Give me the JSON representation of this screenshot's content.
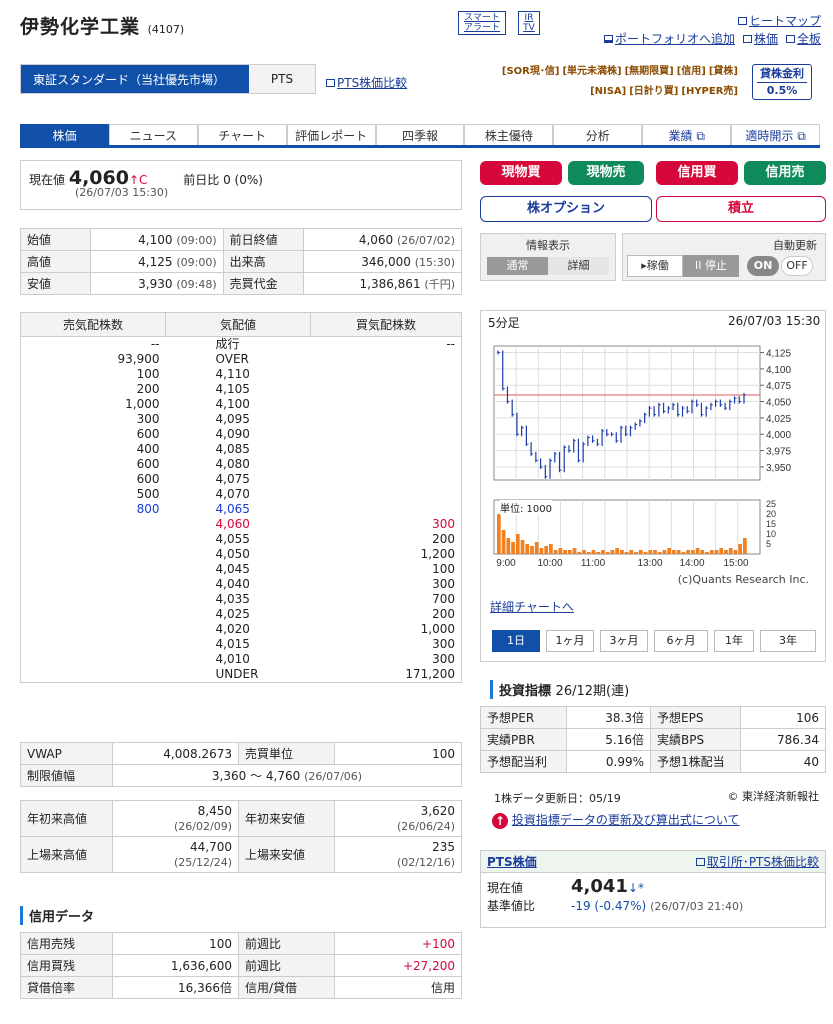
{
  "header": {
    "company": "伊勢化学工業",
    "code": "(4107)",
    "smart_alert": [
      "スマート",
      "アラート"
    ],
    "ir": [
      "IR",
      "TV"
    ],
    "links": {
      "heatmap": "ヒートマップ",
      "portfolio": "ポートフォリオへ追加",
      "stock": "株価",
      "full": "全板"
    }
  },
  "market": {
    "tse": "東証スタンダード（当社優先市場）",
    "pts": "PTS",
    "pts_compare": "PTS株価比較",
    "tags1": [
      "[SOR現･信]",
      "[単元未満株]",
      "[無期限買]",
      "[信用]",
      "[貸株]"
    ],
    "tags2": [
      "[NISA]",
      "[日計り買]",
      "[HYPER売]"
    ],
    "loan": "貸株金利",
    "loan_rate": "0.5%"
  },
  "tabs": [
    "株価",
    "ニュース",
    "チャート",
    "評価レポート",
    "四季報",
    "株主優待",
    "分析",
    "業績",
    "適時開示"
  ],
  "price": {
    "label": "現在値",
    "value": "4,060",
    "arrow": "↑C",
    "change_label": "前日比",
    "change": "0 (0%)",
    "time": "(26/07/03 15:30)"
  },
  "ohlc": [
    [
      "始値",
      "4,100",
      "(09:00)",
      "前日終値",
      "4,060",
      "(26/07/02)"
    ],
    [
      "高値",
      "4,125",
      "(09:00)",
      "出来高",
      "346,000",
      "(15:30)"
    ],
    [
      "安値",
      "3,930",
      "(09:48)",
      "売買代金",
      "1,386,861",
      "(千円)"
    ]
  ],
  "board": {
    "headers": [
      "売気配株数",
      "気配値",
      "買気配株数"
    ],
    "rows": [
      [
        "--",
        "成行",
        "--"
      ],
      [
        "93,900",
        "OVER",
        ""
      ],
      [
        "100",
        "4,110",
        ""
      ],
      [
        "200",
        "4,105",
        ""
      ],
      [
        "1,000",
        "4,100",
        ""
      ],
      [
        "300",
        "4,095",
        ""
      ],
      [
        "600",
        "4,090",
        ""
      ],
      [
        "400",
        "4,085",
        ""
      ],
      [
        "600",
        "4,080",
        ""
      ],
      [
        "600",
        "4,075",
        ""
      ],
      [
        "500",
        "4,070",
        ""
      ],
      [
        "800",
        "4,065",
        ""
      ],
      [
        "",
        "4,060",
        "300"
      ],
      [
        "",
        "4,055",
        "200"
      ],
      [
        "",
        "4,050",
        "1,200"
      ],
      [
        "",
        "4,045",
        "100"
      ],
      [
        "",
        "4,040",
        "300"
      ],
      [
        "",
        "4,035",
        "700"
      ],
      [
        "",
        "4,025",
        "200"
      ],
      [
        "",
        "4,020",
        "1,000"
      ],
      [
        "",
        "4,015",
        "300"
      ],
      [
        "",
        "4,010",
        "300"
      ],
      [
        "",
        "UNDER",
        "171,200"
      ]
    ]
  },
  "vwap": {
    "label": "VWAP",
    "value": "4,008.2673",
    "unit_label": "売買単位",
    "unit": "100",
    "limit_label": "制限値幅",
    "limit": "3,360 ～ 4,760",
    "limit_date": "(26/07/06)"
  },
  "ranges": [
    [
      "年初来高値",
      "8,450",
      "(26/02/09)",
      "年初来安値",
      "3,620",
      "(26/06/24)"
    ],
    [
      "上場来高値",
      "44,700",
      "(25/12/24)",
      "上場来安値",
      "235",
      "(02/12/16)"
    ]
  ],
  "credit": {
    "title": "信用データ",
    "rows": [
      [
        "信用売残",
        "100",
        "前週比",
        "+100"
      ],
      [
        "信用買残",
        "1,636,600",
        "前週比",
        "+27,200"
      ],
      [
        "貸借倍率",
        "16,366倍",
        "信用/貸借",
        "信用"
      ]
    ]
  },
  "buttons": {
    "buy": "現物買",
    "sell": "現物売",
    "mbuy": "信用買",
    "msell": "信用売",
    "option": "株オプション",
    "accum": "積立"
  },
  "display": {
    "label": "情報表示",
    "normal": "通常",
    "detail": "詳細",
    "auto": "自動更新",
    "run": "▸稼働",
    "stop": "II 停止",
    "on": "ON",
    "off": "OFF"
  },
  "chart": {
    "period": "5分足",
    "time": "26/07/03 15:30",
    "unit": "単位: 1000",
    "credit": "(c)Quants Research Inc.",
    "detail_link": "詳細チャートへ",
    "y_ticks": [
      "4,125",
      "4,100",
      "4,075",
      "4,050",
      "4,025",
      "4,000",
      "3,975",
      "3,950"
    ],
    "vol_ticks": [
      "25",
      "20",
      "15",
      "10",
      "5"
    ],
    "x_ticks": [
      "9:00",
      "10:00",
      "11:00",
      "13:00",
      "14:00",
      "15:00"
    ],
    "ranges": [
      "1日",
      "1ヶ月",
      "3ヶ月",
      "6ヶ月",
      "1年",
      "3年"
    ]
  },
  "chart_data": {
    "type": "line",
    "ylim": [
      3930,
      4135
    ],
    "prev_close": 4060,
    "price": [
      4125,
      4070,
      4050,
      4030,
      4000,
      4010,
      3985,
      3970,
      3960,
      3950,
      3935,
      3960,
      3970,
      3945,
      3980,
      3975,
      3990,
      3960,
      3985,
      3995,
      3990,
      3985,
      4005,
      4000,
      4000,
      3990,
      4010,
      4000,
      4010,
      4015,
      4020,
      4030,
      4040,
      4030,
      4045,
      4035,
      4040,
      4045,
      4030,
      4040,
      4035,
      4050,
      4045,
      4030,
      4040,
      4045,
      4050,
      4045,
      4040,
      4050,
      4055,
      4050,
      4060
    ],
    "volume": [
      20,
      12,
      8,
      6,
      10,
      7,
      5,
      4,
      6,
      3,
      4,
      5,
      2,
      3,
      2,
      2,
      3,
      1,
      2,
      1,
      2,
      1,
      2,
      1,
      2,
      3,
      2,
      1,
      2,
      1,
      2,
      1,
      2,
      2,
      1,
      2,
      3,
      2,
      2,
      1,
      2,
      2,
      3,
      2,
      1,
      2,
      2,
      3,
      2,
      3,
      2,
      5,
      8
    ]
  },
  "indicators": {
    "title": "投資指標",
    "period": "26/12期(連)",
    "rows": [
      [
        "予想PER",
        "38.3倍",
        "予想EPS",
        "106"
      ],
      [
        "実績PBR",
        "5.16倍",
        "実績BPS",
        "786.34"
      ],
      [
        "予想配当利",
        "0.99%",
        "予想1株配当",
        "40"
      ]
    ],
    "updated": "1株データ更新日：05/19",
    "source": "© 東洋経済新報社",
    "notice": "投資指標データの更新及び算出式について"
  },
  "pts": {
    "title": "PTS株価",
    "compare": "取引所･PTS株価比較",
    "label": "現在値",
    "value": "4,041",
    "arrow": "↓*",
    "base_label": "基準値比",
    "change": "-19 (-0.47%)",
    "time": "(26/07/03 21:40)"
  }
}
